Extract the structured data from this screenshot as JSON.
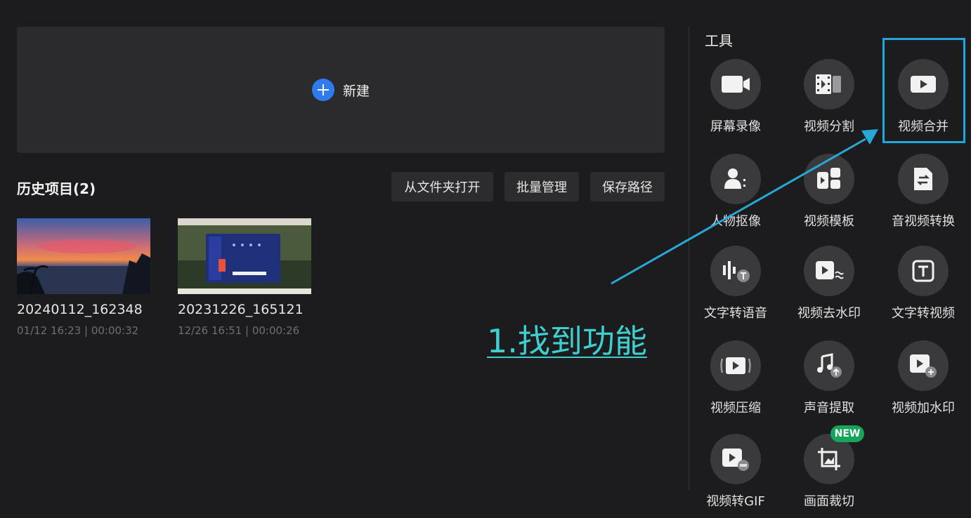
{
  "new_project": {
    "label": "新建"
  },
  "history": {
    "title": "历史项目(2)",
    "buttons": {
      "open_folder": "从文件夹打开",
      "batch_manage": "批量管理",
      "save_path": "保存路径"
    },
    "items": [
      {
        "name": "20240112_162348",
        "meta": "01/12 16:23 | 00:00:32"
      },
      {
        "name": "20231226_165121",
        "meta": "12/26 16:51 | 00:00:26"
      }
    ]
  },
  "annotation": {
    "text": "1.找到功能"
  },
  "tools": {
    "title": "工具",
    "badge": "NEW",
    "items": [
      {
        "label": "屏幕录像",
        "icon": "camera-icon"
      },
      {
        "label": "视频分割",
        "icon": "film-split-icon"
      },
      {
        "label": "视频合并",
        "icon": "video-merge-icon"
      },
      {
        "label": "人物抠像",
        "icon": "person-cutout-icon"
      },
      {
        "label": "视频模板",
        "icon": "template-icon"
      },
      {
        "label": "音视频转换",
        "icon": "file-convert-icon"
      },
      {
        "label": "文字转语音",
        "icon": "text-to-speech-icon"
      },
      {
        "label": "视频去水印",
        "icon": "remove-watermark-icon"
      },
      {
        "label": "文字转视频",
        "icon": "text-to-video-icon"
      },
      {
        "label": "视频压缩",
        "icon": "compress-icon"
      },
      {
        "label": "声音提取",
        "icon": "audio-extract-icon"
      },
      {
        "label": "视频加水印",
        "icon": "add-watermark-icon"
      },
      {
        "label": "视频转GIF",
        "icon": "gif-icon"
      },
      {
        "label": "画面裁切",
        "icon": "crop-icon"
      }
    ]
  }
}
